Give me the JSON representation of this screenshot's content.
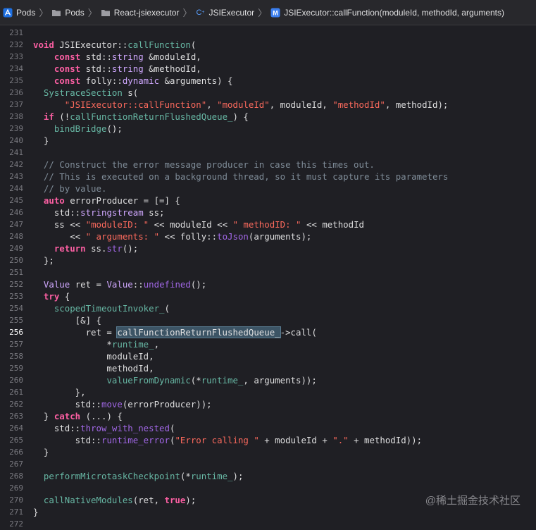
{
  "breadcrumbs": [
    {
      "label": "Pods",
      "icon": "xcode-project-icon"
    },
    {
      "label": "Pods",
      "icon": "folder-icon"
    },
    {
      "label": "React-jsiexecutor",
      "icon": "folder-icon"
    },
    {
      "label": "JSIExecutor",
      "icon": "cpp-file-icon"
    },
    {
      "label": "JSIExecutor::callFunction(moduleId, methodId, arguments)",
      "icon": "method-icon"
    }
  ],
  "current_line": 256,
  "lines": [
    {
      "n": 231,
      "t": []
    },
    {
      "n": 232,
      "t": [
        [
          "kw",
          "void"
        ],
        [
          "p",
          " JSIExecutor::"
        ],
        [
          "fn",
          "callFunction"
        ],
        [
          "p",
          "("
        ]
      ]
    },
    {
      "n": 233,
      "t": [
        [
          "p",
          "    "
        ],
        [
          "kw",
          "const"
        ],
        [
          "p",
          " std::"
        ],
        [
          "ty",
          "string"
        ],
        [
          "p",
          " &moduleId,"
        ]
      ]
    },
    {
      "n": 234,
      "t": [
        [
          "p",
          "    "
        ],
        [
          "kw",
          "const"
        ],
        [
          "p",
          " std::"
        ],
        [
          "ty",
          "string"
        ],
        [
          "p",
          " &methodId,"
        ]
      ]
    },
    {
      "n": 235,
      "t": [
        [
          "p",
          "    "
        ],
        [
          "kw",
          "const"
        ],
        [
          "p",
          " folly::"
        ],
        [
          "ty",
          "dynamic"
        ],
        [
          "p",
          " &arguments) {"
        ]
      ]
    },
    {
      "n": 236,
      "t": [
        [
          "p",
          "  "
        ],
        [
          "fn",
          "SystraceSection"
        ],
        [
          "p",
          " s("
        ]
      ]
    },
    {
      "n": 237,
      "t": [
        [
          "p",
          "      "
        ],
        [
          "str",
          "\"JSIExecutor::callFunction\""
        ],
        [
          "p",
          ", "
        ],
        [
          "str",
          "\"moduleId\""
        ],
        [
          "p",
          ", moduleId, "
        ],
        [
          "str",
          "\"methodId\""
        ],
        [
          "p",
          ", methodId);"
        ]
      ]
    },
    {
      "n": 238,
      "t": [
        [
          "p",
          "  "
        ],
        [
          "kw",
          "if"
        ],
        [
          "p",
          " (!"
        ],
        [
          "fn",
          "callFunctionReturnFlushedQueue_"
        ],
        [
          "p",
          ") {"
        ]
      ]
    },
    {
      "n": 239,
      "t": [
        [
          "p",
          "    "
        ],
        [
          "fn",
          "bindBridge"
        ],
        [
          "p",
          "();"
        ]
      ]
    },
    {
      "n": 240,
      "t": [
        [
          "p",
          "  }"
        ]
      ]
    },
    {
      "n": 241,
      "t": []
    },
    {
      "n": 242,
      "t": [
        [
          "cm",
          "  // Construct the error message producer in case this times out."
        ]
      ]
    },
    {
      "n": 243,
      "t": [
        [
          "cm",
          "  // This is executed on a background thread, so it must capture its parameters"
        ]
      ]
    },
    {
      "n": 244,
      "t": [
        [
          "cm",
          "  // by value."
        ]
      ]
    },
    {
      "n": 245,
      "t": [
        [
          "p",
          "  "
        ],
        [
          "kw",
          "auto"
        ],
        [
          "p",
          " errorProducer = [=] {"
        ]
      ]
    },
    {
      "n": 246,
      "t": [
        [
          "p",
          "    std::"
        ],
        [
          "ty",
          "stringstream"
        ],
        [
          "p",
          " ss;"
        ]
      ]
    },
    {
      "n": 247,
      "t": [
        [
          "p",
          "    ss << "
        ],
        [
          "str",
          "\"moduleID: \""
        ],
        [
          "p",
          " << moduleId << "
        ],
        [
          "str",
          "\" methodID: \""
        ],
        [
          "p",
          " << methodId"
        ]
      ]
    },
    {
      "n": 248,
      "t": [
        [
          "p",
          "       << "
        ],
        [
          "str",
          "\" arguments: \""
        ],
        [
          "p",
          " << folly::"
        ],
        [
          "mt",
          "toJson"
        ],
        [
          "p",
          "(arguments);"
        ]
      ]
    },
    {
      "n": 249,
      "t": [
        [
          "p",
          "    "
        ],
        [
          "kw",
          "return"
        ],
        [
          "p",
          " ss."
        ],
        [
          "mt",
          "str"
        ],
        [
          "p",
          "();"
        ]
      ]
    },
    {
      "n": 250,
      "t": [
        [
          "p",
          "  };"
        ]
      ]
    },
    {
      "n": 251,
      "t": []
    },
    {
      "n": 252,
      "t": [
        [
          "p",
          "  "
        ],
        [
          "ty",
          "Value"
        ],
        [
          "p",
          " ret = "
        ],
        [
          "ty",
          "Value"
        ],
        [
          "p",
          "::"
        ],
        [
          "mt",
          "undefined"
        ],
        [
          "p",
          "();"
        ]
      ]
    },
    {
      "n": 253,
      "t": [
        [
          "p",
          "  "
        ],
        [
          "kw",
          "try"
        ],
        [
          "p",
          " {"
        ]
      ]
    },
    {
      "n": 254,
      "t": [
        [
          "p",
          "    "
        ],
        [
          "fn",
          "scopedTimeoutInvoker_"
        ],
        [
          "p",
          "("
        ]
      ]
    },
    {
      "n": 255,
      "t": [
        [
          "p",
          "        [&] {"
        ]
      ]
    },
    {
      "n": 256,
      "t": [
        [
          "p",
          "          ret = "
        ],
        [
          "hl",
          "callFunctionReturnFlushedQueue_"
        ],
        [
          "p",
          "->call("
        ]
      ]
    },
    {
      "n": 257,
      "t": [
        [
          "p",
          "              *"
        ],
        [
          "fn",
          "runtime_"
        ],
        [
          "p",
          ","
        ]
      ]
    },
    {
      "n": 258,
      "t": [
        [
          "p",
          "              moduleId,"
        ]
      ]
    },
    {
      "n": 259,
      "t": [
        [
          "p",
          "              methodId,"
        ]
      ]
    },
    {
      "n": 260,
      "t": [
        [
          "p",
          "              "
        ],
        [
          "fn",
          "valueFromDynamic"
        ],
        [
          "p",
          "(*"
        ],
        [
          "fn",
          "runtime_"
        ],
        [
          "p",
          ", arguments));"
        ]
      ]
    },
    {
      "n": 261,
      "t": [
        [
          "p",
          "        },"
        ]
      ]
    },
    {
      "n": 262,
      "t": [
        [
          "p",
          "        std::"
        ],
        [
          "mt",
          "move"
        ],
        [
          "p",
          "(errorProducer));"
        ]
      ]
    },
    {
      "n": 263,
      "t": [
        [
          "p",
          "  } "
        ],
        [
          "kw",
          "catch"
        ],
        [
          "p",
          " (...) {"
        ]
      ]
    },
    {
      "n": 264,
      "t": [
        [
          "p",
          "    std::"
        ],
        [
          "mt",
          "throw_with_nested"
        ],
        [
          "p",
          "("
        ]
      ]
    },
    {
      "n": 265,
      "t": [
        [
          "p",
          "        std::"
        ],
        [
          "mt",
          "runtime_error"
        ],
        [
          "p",
          "("
        ],
        [
          "str",
          "\"Error calling \""
        ],
        [
          "p",
          " + moduleId + "
        ],
        [
          "str",
          "\".\""
        ],
        [
          "p",
          " + methodId));"
        ]
      ]
    },
    {
      "n": 266,
      "t": [
        [
          "p",
          "  }"
        ]
      ]
    },
    {
      "n": 267,
      "t": []
    },
    {
      "n": 268,
      "t": [
        [
          "p",
          "  "
        ],
        [
          "fn",
          "performMicrotaskCheckpoint"
        ],
        [
          "p",
          "(*"
        ],
        [
          "fn",
          "runtime_"
        ],
        [
          "p",
          ");"
        ]
      ]
    },
    {
      "n": 269,
      "t": []
    },
    {
      "n": 270,
      "t": [
        [
          "p",
          "  "
        ],
        [
          "fn",
          "callNativeModules"
        ],
        [
          "p",
          "(ret, "
        ],
        [
          "kw",
          "true"
        ],
        [
          "p",
          ");"
        ]
      ]
    },
    {
      "n": 271,
      "t": [
        [
          "p",
          "}"
        ]
      ]
    },
    {
      "n": 272,
      "t": []
    }
  ],
  "watermark": "@稀土掘金技术社区"
}
